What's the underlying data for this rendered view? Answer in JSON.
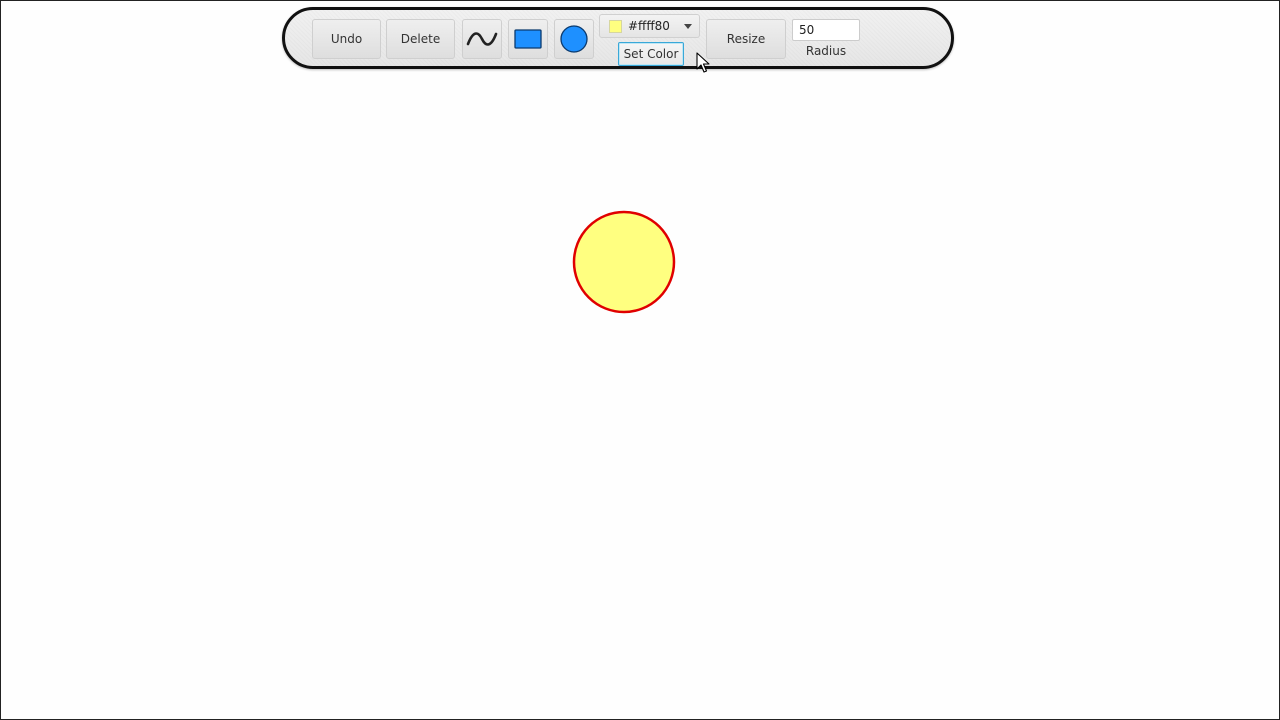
{
  "toolbar": {
    "undo_label": "Undo",
    "delete_label": "Delete",
    "resize_label": "Resize",
    "set_color_label": "Set Color",
    "radius_value": "50",
    "radius_label": "Radius"
  },
  "tools": {
    "line_icon": "curve-line-icon",
    "rect_icon": "rectangle-icon",
    "circle_icon": "circle-icon",
    "tool_color": "#1e90ff"
  },
  "color_picker": {
    "value": "#ffff80",
    "swatch_color": "#ffff80"
  },
  "canvas": {
    "shape_type": "circle",
    "fill_color": "#ffff80",
    "stroke_color": "#e00000",
    "radius": 50
  }
}
